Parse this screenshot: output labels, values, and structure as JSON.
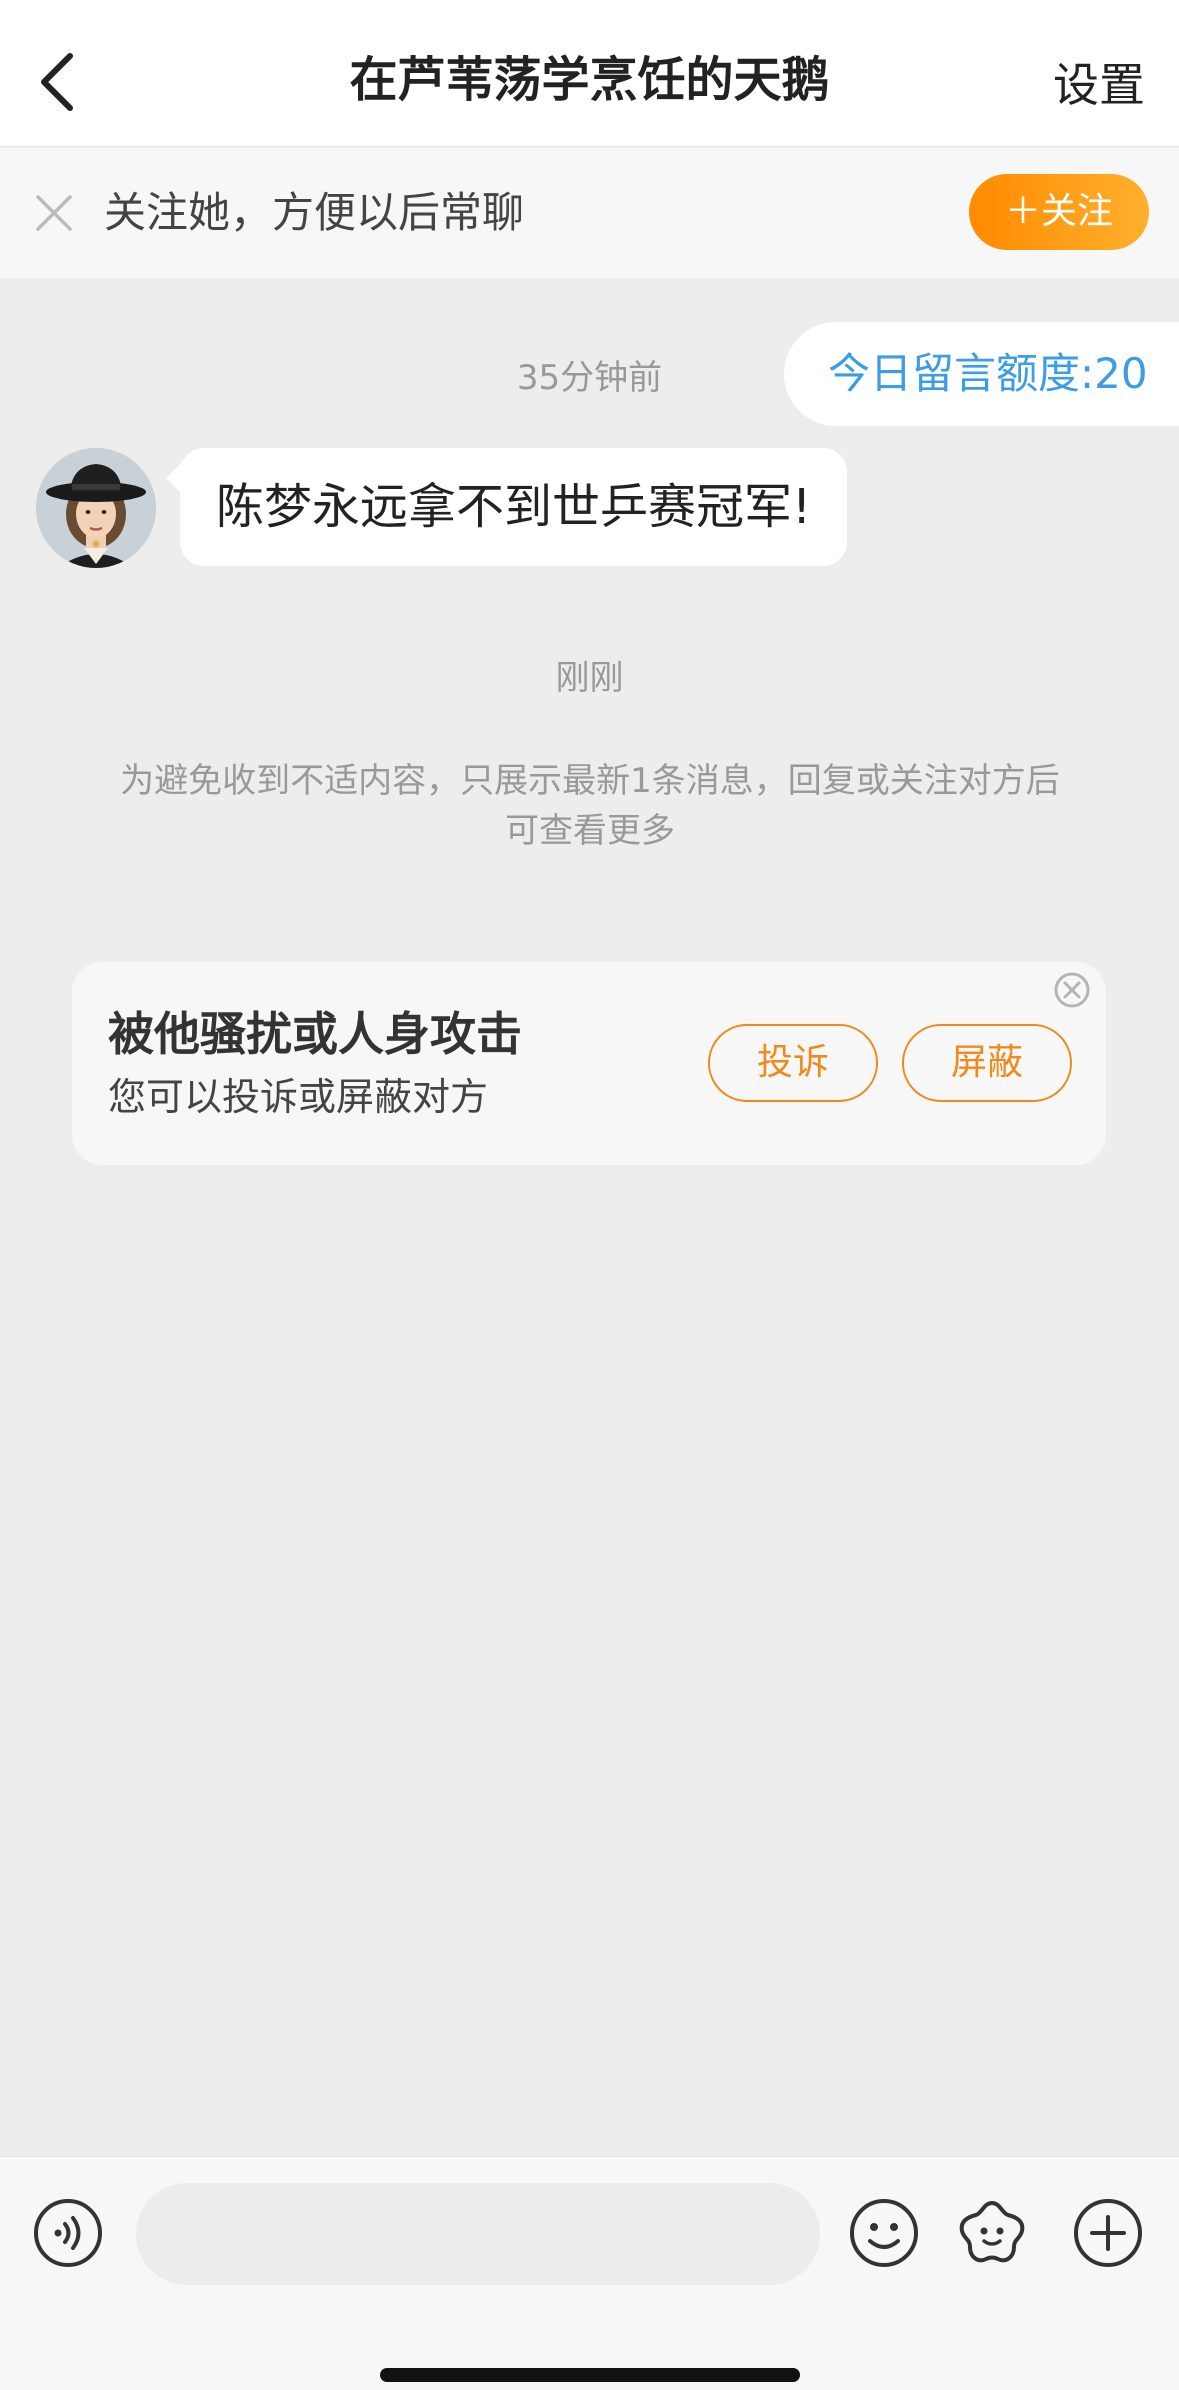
{
  "navbar": {
    "title": "在芦苇荡学烹饪的天鹅",
    "settings_label": "设置",
    "back_icon": "chevron-left-icon"
  },
  "follow_banner": {
    "text": "关注她，方便以后常聊",
    "follow_button": "＋关注",
    "close_icon": "close-icon"
  },
  "chat": {
    "quota_label": "今日留言额度:20",
    "timestamp_1": "35分钟前",
    "message_1": "陈梦永远拿不到世乒赛冠军!",
    "timestamp_2": "刚刚",
    "notice": "为避免收到不适内容，只展示最新1条消息，回复或关注对方后可查看更多"
  },
  "report_card": {
    "title": "被他骚扰或人身攻击",
    "subtitle": "您可以投诉或屏蔽对方",
    "report_button": "投诉",
    "block_button": "屏蔽"
  },
  "input_bar": {
    "placeholder": "",
    "icons": [
      "voice-icon",
      "emoji-icon",
      "sticker-icon",
      "plus-icon"
    ]
  },
  "colors": {
    "accent_orange": "#f08a1c",
    "quota_blue": "#3a9de6",
    "background": "#ededed"
  }
}
